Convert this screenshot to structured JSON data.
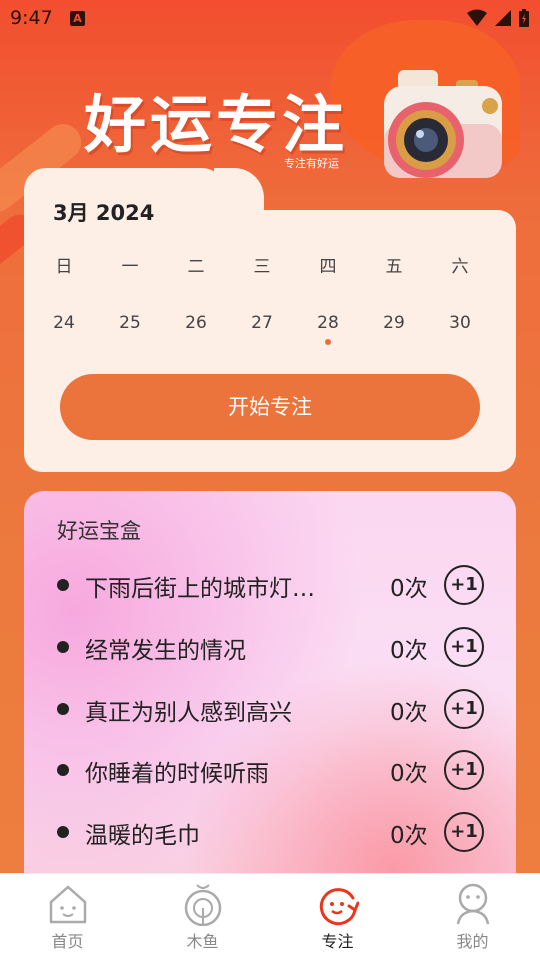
{
  "status_bar": {
    "time": "9:47",
    "badge": "A"
  },
  "hero": {
    "title": "好运专注",
    "subtitle": "专注有好运"
  },
  "calendar": {
    "month_label": "3月  2024",
    "weekdays": [
      "日",
      "一",
      "二",
      "三",
      "四",
      "五",
      "六"
    ],
    "days": [
      "24",
      "25",
      "26",
      "27",
      "28",
      "29",
      "30"
    ],
    "today": "28",
    "start_button": "开始专注"
  },
  "lucky_box": {
    "title": "好运宝盒",
    "items": [
      {
        "text": "下雨后街上的城市灯…",
        "count": "0次",
        "action": "+1"
      },
      {
        "text": "经常发生的情况",
        "count": "0次",
        "action": "+1"
      },
      {
        "text": "真正为别人感到高兴",
        "count": "0次",
        "action": "+1"
      },
      {
        "text": "你睡着的时候听雨",
        "count": "0次",
        "action": "+1"
      },
      {
        "text": "温暖的毛巾",
        "count": "0次",
        "action": "+1"
      }
    ]
  },
  "tabs": [
    {
      "label": "首页",
      "icon": "home-icon"
    },
    {
      "label": "木鱼",
      "icon": "wooden-fish-icon"
    },
    {
      "label": "专注",
      "icon": "focus-icon",
      "active": true
    },
    {
      "label": "我的",
      "icon": "profile-icon"
    }
  ],
  "colors": {
    "accent": "#eb733c",
    "header_red": "#f24e2f",
    "card_bg": "#fdeee6",
    "tab_active": "#e8371f"
  }
}
